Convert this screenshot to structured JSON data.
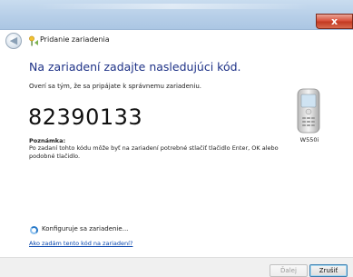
{
  "window": {
    "close_glyph": "x",
    "back_glyph": "◀",
    "title": "Pridanie zariadenia"
  },
  "main": {
    "heading": "Na zariadení zadajte nasledujúci kód.",
    "instruction": "Overí sa tým, že sa pripájate k správnemu zariadeniu.",
    "code": "82390133",
    "note_label": "Poznámka:",
    "note_text": "Po zadaní tohto kódu môže byť na zariadení potrebné stlačiť tlačidlo Enter, OK alebo podobné tlačidlo."
  },
  "device": {
    "label": "W550i",
    "icon": "mobile-phone-icon"
  },
  "status": {
    "progress_text": "Konfiguruje sa zariadenie...",
    "help_link": "Ako zadám tento kód na zariadení?"
  },
  "footer": {
    "next_label": "Ďalej",
    "cancel_label": "Zrušiť"
  }
}
